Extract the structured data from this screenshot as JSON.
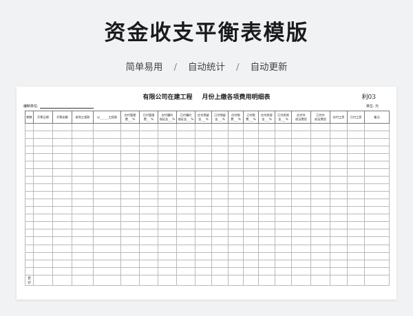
{
  "hero": {
    "title": "资金收支平衡表模版",
    "features": [
      "简单易用",
      "自动统计",
      "自动更新"
    ],
    "separator": "/"
  },
  "document": {
    "company": "有限公司在建工程",
    "period_title": "月份上缴各项费用明细表",
    "code": "利03",
    "unit_label": "编制单位:",
    "currency_label": "单位: 元",
    "columns": [
      "期数",
      "开票日期",
      "开票金额",
      "收到工程款",
      "以______工程款",
      "应付管理\n费___%",
      "已付管理\n费___%",
      "应付履约\n保证金___%",
      "已付履约\n保证金___%",
      "应付预留\n金___%",
      "已付预留\n金___%",
      "应付税\n费___%",
      "已付税\n费___%",
      "应付质保\n金___%",
      "已付质保\n金___%",
      "应付外\n经证费用",
      "已付外\n经证费用",
      "应付工资",
      "已付工资",
      "备注"
    ],
    "total_label": "合计",
    "row_count": 20
  }
}
